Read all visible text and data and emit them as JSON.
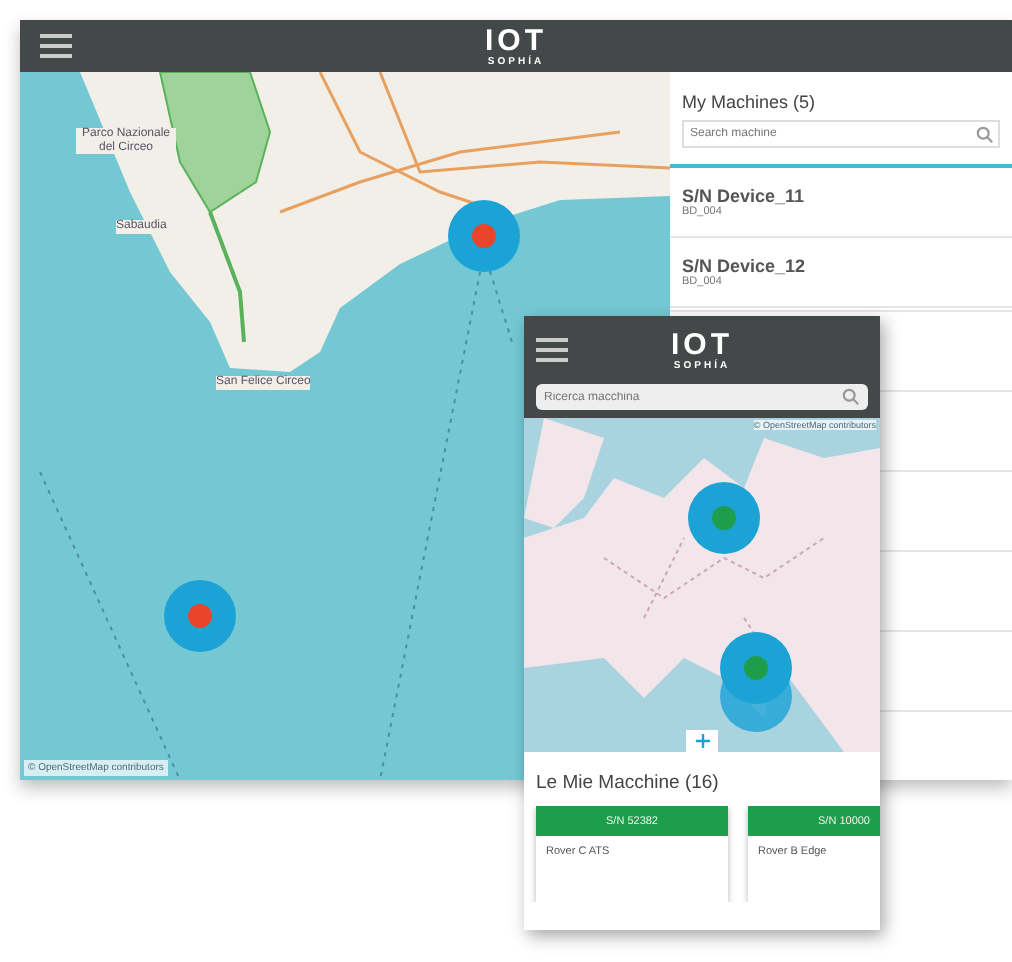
{
  "tablet": {
    "logo": {
      "mark": "IOT",
      "name": "SOPHÍA"
    },
    "map": {
      "labels": [
        "Parco Nazionale del Circeo",
        "Sabaudia",
        "San Felice Circeo"
      ],
      "markers": [
        {
          "color": "#e8452c"
        },
        {
          "color": "#e8452c"
        }
      ],
      "attribution": "© OpenStreetMap contributors"
    },
    "panel": {
      "title": "My Machines (5)",
      "search": {
        "placeholder": "Search machine"
      },
      "machines": [
        {
          "name": "S/N Device_11",
          "model": "BD_004"
        },
        {
          "name": "S/N Device_12",
          "model": "BD_004"
        }
      ]
    }
  },
  "phone": {
    "logo": {
      "mark": "IOT",
      "name": "SOPHÍA"
    },
    "search": {
      "placeholder": "Ricerca macchina"
    },
    "map": {
      "attribution": "© OpenStreetMap contributors",
      "markers": [
        {
          "color": "#1e9e4a"
        },
        {
          "color": "#1e9e4a"
        }
      ]
    },
    "title": "Le Mie Macchine (16)",
    "cards": [
      {
        "serial": "S/N 52382",
        "model": "Rover C ATS"
      },
      {
        "serial": "S/N 10000",
        "model": "Rover B Edge"
      }
    ]
  }
}
